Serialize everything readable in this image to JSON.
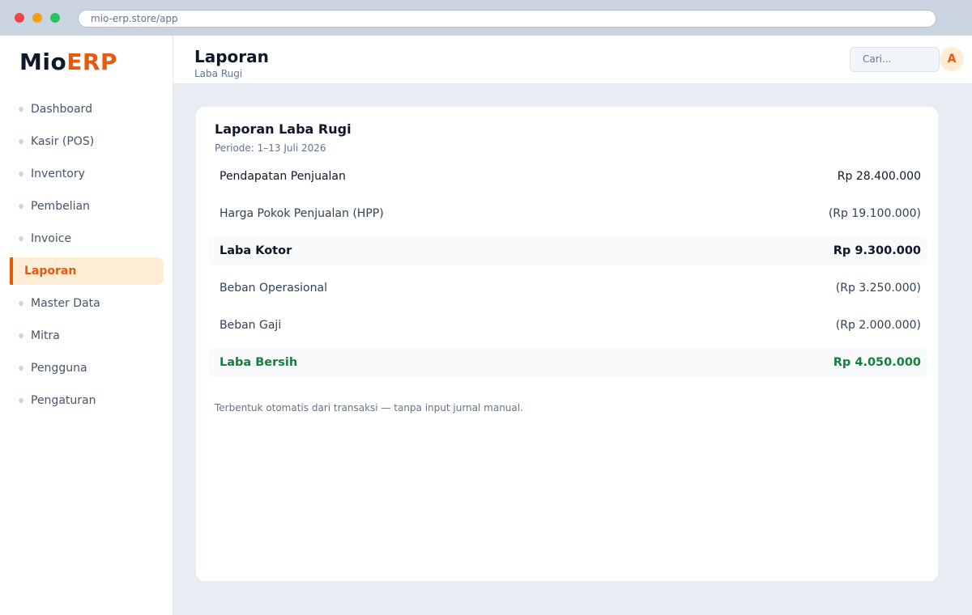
{
  "browser": {
    "url": "mio-erp.store/app"
  },
  "brand": {
    "name_part1": "Mio",
    "name_part2": "ERP",
    "accent_color": "#ea580c"
  },
  "sidebar": {
    "items": [
      {
        "label": "Dashboard",
        "active": false
      },
      {
        "label": "Kasir (POS)",
        "active": false
      },
      {
        "label": "Inventory",
        "active": false
      },
      {
        "label": "Pembelian",
        "active": false
      },
      {
        "label": "Invoice",
        "active": false
      },
      {
        "label": "Laporan",
        "active": true
      },
      {
        "label": "Master Data",
        "active": false
      },
      {
        "label": "Mitra",
        "active": false
      },
      {
        "label": "Pengguna",
        "active": false
      },
      {
        "label": "Pengaturan",
        "active": false
      }
    ]
  },
  "header": {
    "title": "Laporan",
    "subtitle": "Laba Rugi",
    "search_placeholder": "Cari...",
    "avatar_initial": "A"
  },
  "report": {
    "title": "Laporan Laba Rugi",
    "period": "Periode: 1–13 Juli 2026",
    "rows": [
      {
        "label": "Pendapatan Penjualan",
        "value": "Rp 28.400.000"
      },
      {
        "label": "Harga Pokok Penjualan (HPP)",
        "value": "(Rp 19.100.000)"
      },
      {
        "label": "Laba Kotor",
        "value": "Rp 9.300.000"
      },
      {
        "label": "Beban Operasional",
        "value": "(Rp 3.250.000)"
      },
      {
        "label": "Beban Gaji",
        "value": "(Rp 2.000.000)"
      },
      {
        "label": "Laba Bersih",
        "value": "Rp 4.050.000"
      }
    ],
    "note": "Terbentuk otomatis dari transaksi — tanpa input jurnal manual.",
    "net_color": "#15803d"
  }
}
